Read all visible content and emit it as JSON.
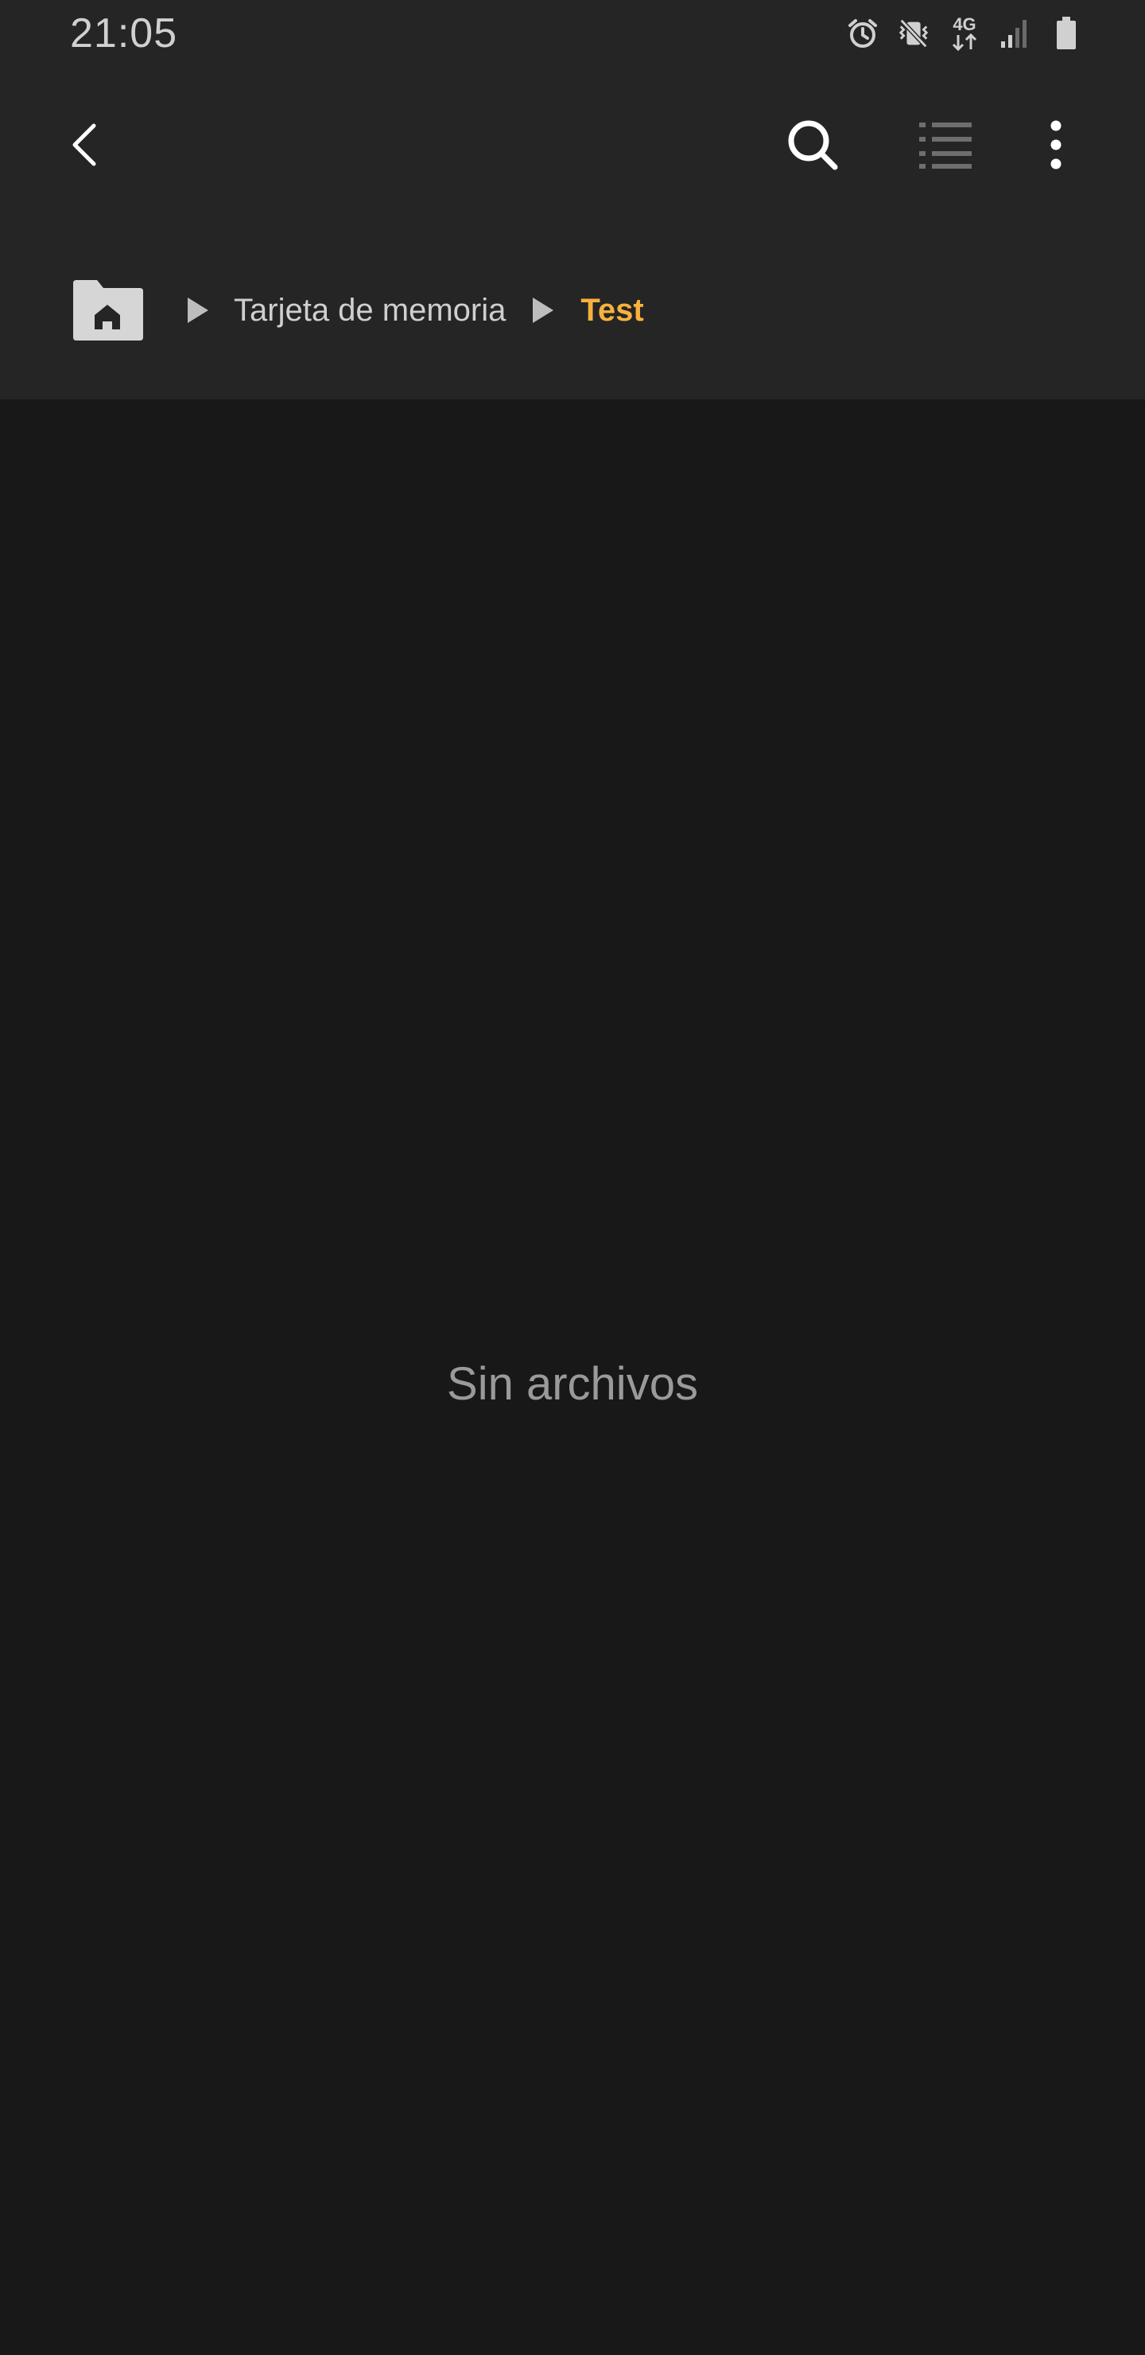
{
  "status_bar": {
    "time": "21:05",
    "network_label": "4G",
    "icons": [
      "alarm-icon",
      "vibrate-mute-icon",
      "4g-data-icon",
      "signal-icon",
      "battery-icon"
    ]
  },
  "toolbar": {
    "icons": [
      "back-icon",
      "search-icon",
      "list-view-icon",
      "more-options-icon"
    ]
  },
  "breadcrumb": {
    "home_icon": "home-folder-icon",
    "items": [
      "Tarjeta de memoria",
      "Test"
    ]
  },
  "main": {
    "empty_message": "Sin archivos"
  },
  "colors": {
    "header_background": "#252525",
    "page_background": "#181818",
    "accent": "#f6b23c"
  }
}
